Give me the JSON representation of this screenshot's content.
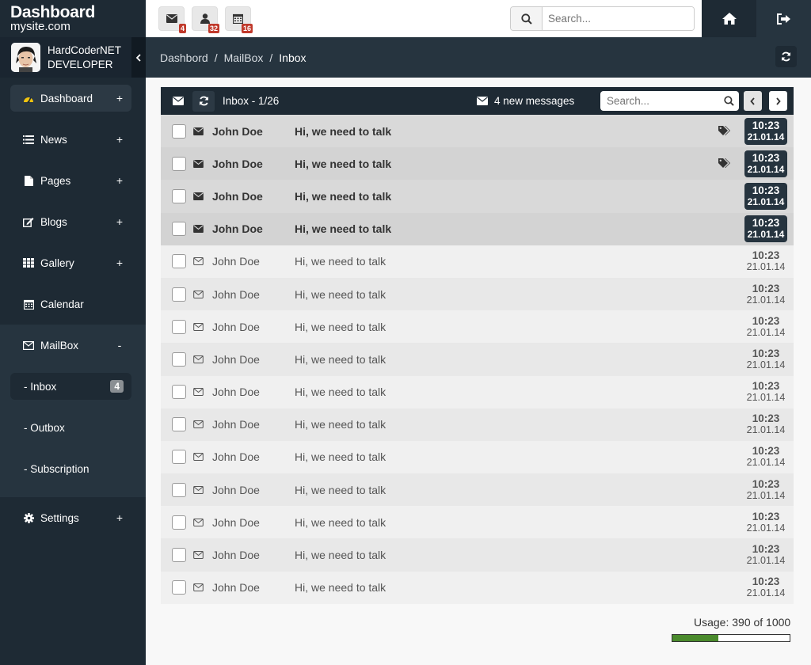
{
  "brand": {
    "title": "Dashboard",
    "subtitle": "mysite.com"
  },
  "user": {
    "name": "HardCoderNET",
    "role": "DEVELOPER"
  },
  "sidebar": {
    "items": [
      {
        "label": "Dashboard",
        "icon": "dashboard-icon",
        "toggle": "+"
      },
      {
        "label": "News",
        "icon": "list-icon",
        "toggle": "+"
      },
      {
        "label": "Pages",
        "icon": "file-icon",
        "toggle": "+"
      },
      {
        "label": "Blogs",
        "icon": "edit-icon",
        "toggle": "+"
      },
      {
        "label": "Gallery",
        "icon": "grid-icon",
        "toggle": "+"
      },
      {
        "label": "Calendar",
        "icon": "calendar-icon",
        "toggle": ""
      },
      {
        "label": "MailBox",
        "icon": "mail-icon",
        "toggle": "-"
      },
      {
        "label": "Settings",
        "icon": "gear-icon",
        "toggle": "+"
      }
    ],
    "mailbox_sub": [
      {
        "label": "- Inbox",
        "badge": "4"
      },
      {
        "label": "- Outbox"
      },
      {
        "label": "- Subscription"
      }
    ]
  },
  "topbar": {
    "mail_badge": "4",
    "users_badge": "32",
    "calendar_badge": "16",
    "search_placeholder": "Search..."
  },
  "breadcrumb": {
    "items": [
      "Dashbord",
      "MailBox"
    ],
    "current": "Inbox"
  },
  "inbox": {
    "title": "Inbox - 1/26",
    "new_messages": "4 new messages",
    "search_placeholder": "Search...",
    "messages": [
      {
        "sender": "John Doe",
        "subject": "Hi, we need to talk",
        "time": "10:23",
        "date": "21.01.14",
        "unread": true,
        "tagged": true
      },
      {
        "sender": "John Doe",
        "subject": "Hi, we need to talk",
        "time": "10:23",
        "date": "21.01.14",
        "unread": true,
        "tagged": true
      },
      {
        "sender": "John Doe",
        "subject": "Hi, we need to talk",
        "time": "10:23",
        "date": "21.01.14",
        "unread": true,
        "tagged": false
      },
      {
        "sender": "John Doe",
        "subject": "Hi, we need to talk",
        "time": "10:23",
        "date": "21.01.14",
        "unread": true,
        "tagged": false
      },
      {
        "sender": "John Doe",
        "subject": "Hi, we need to talk",
        "time": "10:23",
        "date": "21.01.14",
        "unread": false,
        "tagged": false
      },
      {
        "sender": "John Doe",
        "subject": "Hi, we need to talk",
        "time": "10:23",
        "date": "21.01.14",
        "unread": false,
        "tagged": false
      },
      {
        "sender": "John Doe",
        "subject": "Hi, we need to talk",
        "time": "10:23",
        "date": "21.01.14",
        "unread": false,
        "tagged": false
      },
      {
        "sender": "John Doe",
        "subject": "Hi, we need to talk",
        "time": "10:23",
        "date": "21.01.14",
        "unread": false,
        "tagged": false
      },
      {
        "sender": "John Doe",
        "subject": "Hi, we need to talk",
        "time": "10:23",
        "date": "21.01.14",
        "unread": false,
        "tagged": false
      },
      {
        "sender": "John Doe",
        "subject": "Hi, we need to talk",
        "time": "10:23",
        "date": "21.01.14",
        "unread": false,
        "tagged": false
      },
      {
        "sender": "John Doe",
        "subject": "Hi, we need to talk",
        "time": "10:23",
        "date": "21.01.14",
        "unread": false,
        "tagged": false
      },
      {
        "sender": "John Doe",
        "subject": "Hi, we need to talk",
        "time": "10:23",
        "date": "21.01.14",
        "unread": false,
        "tagged": false
      },
      {
        "sender": "John Doe",
        "subject": "Hi, we need to talk",
        "time": "10:23",
        "date": "21.01.14",
        "unread": false,
        "tagged": false
      },
      {
        "sender": "John Doe",
        "subject": "Hi, we need to talk",
        "time": "10:23",
        "date": "21.01.14",
        "unread": false,
        "tagged": false
      },
      {
        "sender": "John Doe",
        "subject": "Hi, we need to talk",
        "time": "10:23",
        "date": "21.01.14",
        "unread": false,
        "tagged": false
      }
    ]
  },
  "usage": {
    "label": "Usage: 390 of 1000",
    "used": 390,
    "total": 1000
  },
  "colors": {
    "sidebar": "#1e2a34",
    "accent_green": "#4a8a2c",
    "badge_red": "#c0392b",
    "dashboard_icon": "#f1c40f"
  }
}
